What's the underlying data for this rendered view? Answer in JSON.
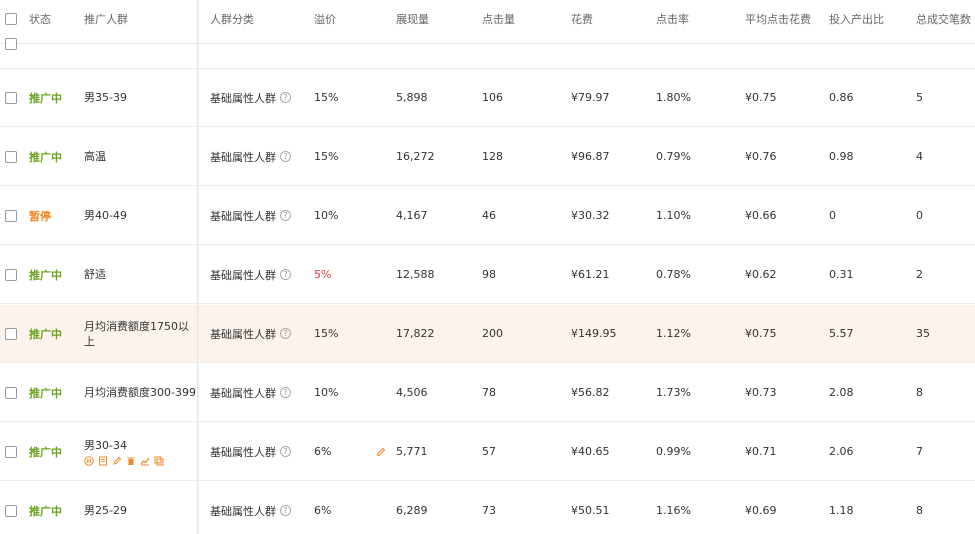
{
  "columns": {
    "status": "状态",
    "crowd": "推广人群",
    "category": "人群分类",
    "premium": "溢价",
    "impressions": "展现量",
    "clicks": "点击量",
    "cost": "花费",
    "ctr": "点击率",
    "avg_cpc": "平均点击花费",
    "roi": "投入产出比",
    "deals": "总成交笔数"
  },
  "rows": [
    {
      "status": "推广中",
      "status_type": "on",
      "name_lines": [
        "男35-39"
      ],
      "category": "基础属性人群",
      "premium": "15%",
      "premium_red": false,
      "impressions": "5,898",
      "clicks": "106",
      "cost": "¥79.97",
      "ctr": "1.80%",
      "avg_cpc": "¥0.75",
      "roi": "0.86",
      "deals": "5"
    },
    {
      "status": "推广中",
      "status_type": "on",
      "name_lines": [
        "高温"
      ],
      "category": "基础属性人群",
      "premium": "15%",
      "premium_red": false,
      "impressions": "16,272",
      "clicks": "128",
      "cost": "¥96.87",
      "ctr": "0.79%",
      "avg_cpc": "¥0.76",
      "roi": "0.98",
      "deals": "4"
    },
    {
      "status": "暂停",
      "status_type": "pause",
      "name_lines": [
        "男40-49"
      ],
      "category": "基础属性人群",
      "premium": "10%",
      "premium_red": false,
      "impressions": "4,167",
      "clicks": "46",
      "cost": "¥30.32",
      "ctr": "1.10%",
      "avg_cpc": "¥0.66",
      "roi": "0",
      "deals": "0"
    },
    {
      "status": "推广中",
      "status_type": "on",
      "name_lines": [
        "舒适"
      ],
      "category": "基础属性人群",
      "premium": "5%",
      "premium_red": true,
      "impressions": "12,588",
      "clicks": "98",
      "cost": "¥61.21",
      "ctr": "0.78%",
      "avg_cpc": "¥0.62",
      "roi": "0.31",
      "deals": "2"
    },
    {
      "status": "推广中",
      "status_type": "on",
      "name_lines": [
        "月均消费额度1750以",
        "上"
      ],
      "category": "基础属性人群",
      "premium": "15%",
      "premium_red": false,
      "impressions": "17,822",
      "clicks": "200",
      "cost": "¥149.95",
      "ctr": "1.12%",
      "avg_cpc": "¥0.75",
      "roi": "5.57",
      "deals": "35",
      "highlight": true
    },
    {
      "status": "推广中",
      "status_type": "on",
      "name_lines": [
        "月均消费额度300-399"
      ],
      "category": "基础属性人群",
      "premium": "10%",
      "premium_red": false,
      "impressions": "4,506",
      "clicks": "78",
      "cost": "¥56.82",
      "ctr": "1.73%",
      "avg_cpc": "¥0.73",
      "roi": "2.08",
      "deals": "8"
    },
    {
      "status": "推广中",
      "status_type": "on",
      "name_lines": [
        "男30-34"
      ],
      "category": "基础属性人群",
      "premium": "6%",
      "premium_red": false,
      "impressions": "5,771",
      "clicks": "57",
      "cost": "¥40.65",
      "ctr": "0.99%",
      "avg_cpc": "¥0.71",
      "roi": "2.06",
      "deals": "7",
      "actions": true
    },
    {
      "status": "推广中",
      "status_type": "on",
      "name_lines": [
        "男25-29"
      ],
      "category": "基础属性人群",
      "premium": "6%",
      "premium_red": false,
      "impressions": "6,289",
      "clicks": "73",
      "cost": "¥50.51",
      "ctr": "1.16%",
      "avg_cpc": "¥0.69",
      "roi": "1.18",
      "deals": "8"
    }
  ],
  "row_action_icons": [
    "pause-icon",
    "note-icon",
    "edit-icon",
    "delete-icon",
    "chart-icon",
    "copy-icon"
  ],
  "colors": {
    "status_on": "#6aa51e",
    "status_pause": "#f08a24",
    "premium_red": "#e5383b",
    "highlight_row": "#fbf3ec"
  }
}
